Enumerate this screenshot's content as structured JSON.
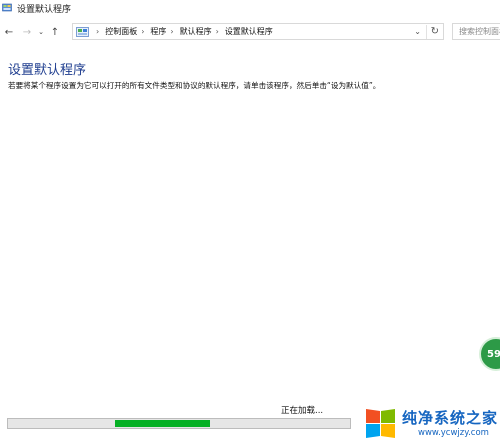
{
  "window": {
    "title": "设置默认程序",
    "icon": "control-panel-icon"
  },
  "nav": {
    "back_icon": "arrow-left-icon",
    "forward_icon": "arrow-right-icon",
    "recent_icon": "chevron-down-icon",
    "up_icon": "arrow-up-icon",
    "breadcrumbs": [
      "控制面板",
      "程序",
      "默认程序",
      "设置默认程序"
    ],
    "search_placeholder": "搜索控制面板"
  },
  "main": {
    "heading": "设置默认程序",
    "description": "若要将某个程序设置为它可以打开的所有文件类型和协议的默认程序，请单击该程序，然后单击“设为默认值”。",
    "loading_text": "正在加载...",
    "progress_color": "#06b025"
  },
  "overlay": {
    "badge_text": "59"
  },
  "watermark": {
    "title": "纯净系统之家",
    "url": "www.ycwjzy.com"
  }
}
